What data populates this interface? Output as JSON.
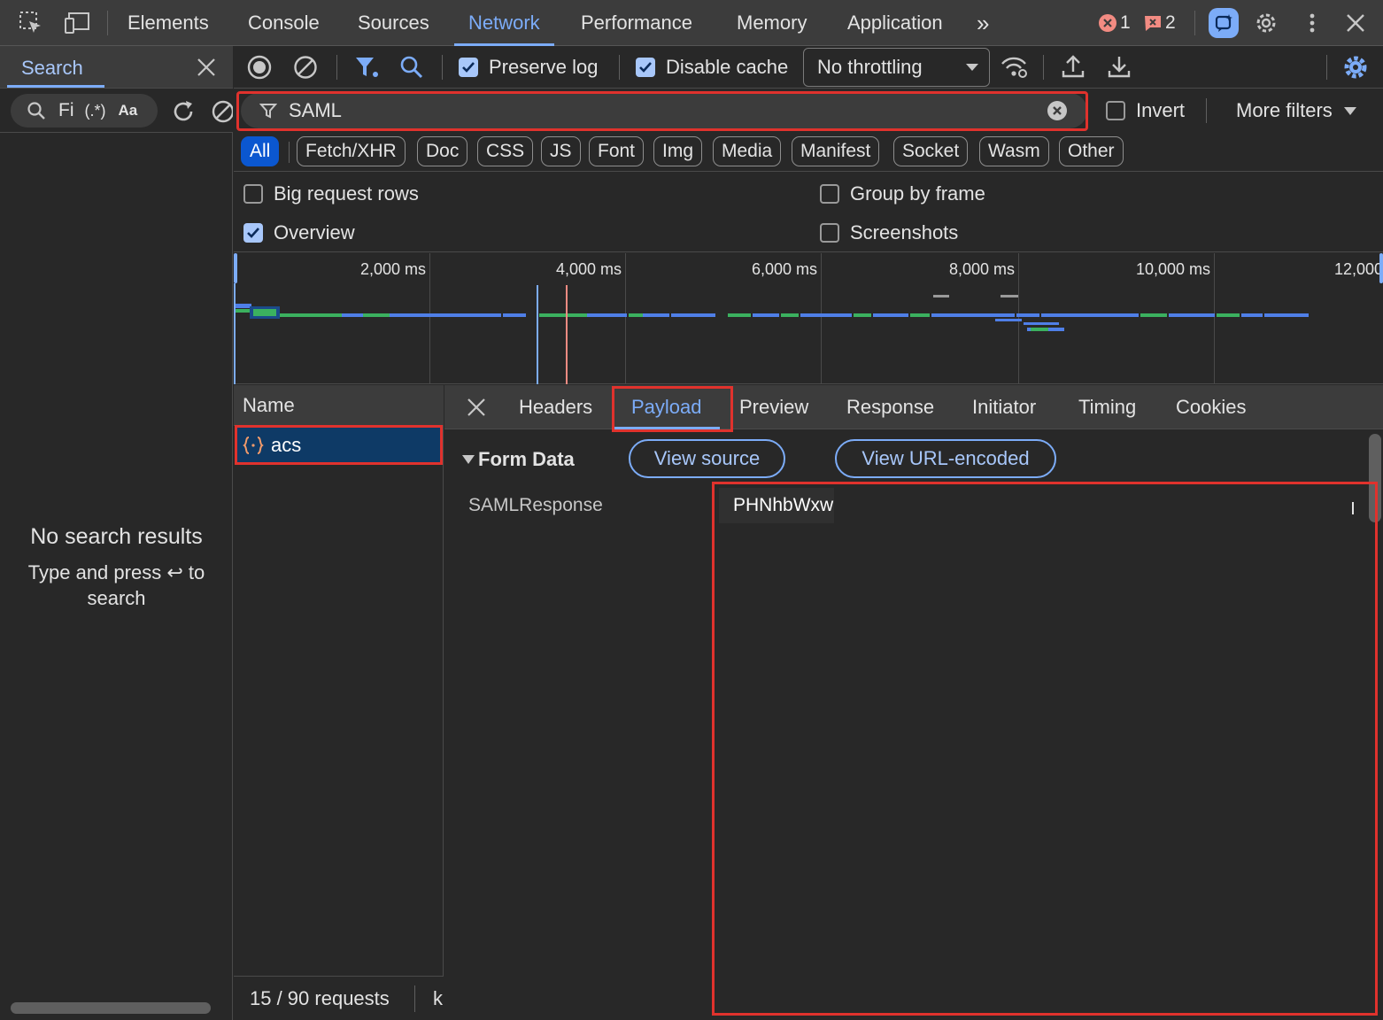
{
  "topbar": {
    "tabs": [
      "Elements",
      "Console",
      "Sources",
      "Network",
      "Performance",
      "Memory",
      "Application"
    ],
    "active_tab": "Network",
    "more_tabs_glyph": "»",
    "error_count": "1",
    "issue_count": "2",
    "icons": [
      "inspect-element-icon",
      "device-toolbar-icon",
      "error-icon",
      "issue-icon",
      "ai-assistance-icon",
      "settings-icon",
      "more-vert-icon",
      "close-icon"
    ]
  },
  "search_panel": {
    "title": "Search",
    "find_placeholder": "Fi",
    "regex_label": "(.*)",
    "case_label": "Aa",
    "no_results_title": "No search results",
    "no_results_hint": "Type and press ↩ to search"
  },
  "toolbar": {
    "preserve_log_label": "Preserve log",
    "preserve_log_checked": true,
    "disable_cache_label": "Disable cache",
    "disable_cache_checked": true,
    "throttling_value": "No throttling"
  },
  "filter": {
    "value": "SAML",
    "invert_label": "Invert",
    "more_filters_label": "More filters"
  },
  "type_filters": [
    "All",
    "Fetch/XHR",
    "Doc",
    "CSS",
    "JS",
    "Font",
    "Img",
    "Media",
    "Manifest",
    "Socket",
    "Wasm",
    "Other"
  ],
  "active_type_filter": "All",
  "settings": {
    "big_request_rows": "Big request rows",
    "group_by_frame": "Group by frame",
    "overview": "Overview",
    "screenshots": "Screenshots",
    "overview_checked": true
  },
  "timeline": {
    "ticks": [
      "2,000 ms",
      "4,000 ms",
      "6,000 ms",
      "8,000 ms",
      "10,000 ms",
      "12,000"
    ],
    "colors": {
      "waiting": "#4f7fe8",
      "download": "#3bb15f",
      "dom_loaded": "#7cacf8",
      "load": "#f28b82"
    }
  },
  "requests": {
    "column_name": "Name",
    "rows": [
      {
        "name": "acs",
        "type_icon": "xhr-braces-icon"
      }
    ],
    "summary": "15 / 90 requests",
    "summary_tail": "k"
  },
  "details": {
    "tabs": [
      "Headers",
      "Payload",
      "Preview",
      "Response",
      "Initiator",
      "Timing",
      "Cookies"
    ],
    "active_tab": "Payload",
    "section_title": "Form Data",
    "view_source_label": "View source",
    "view_url_encoded_label": "View URL-encoded",
    "field_name": "SAMLResponse",
    "field_value": "PHNhbWxw"
  },
  "highlight_color": "#e0322d"
}
